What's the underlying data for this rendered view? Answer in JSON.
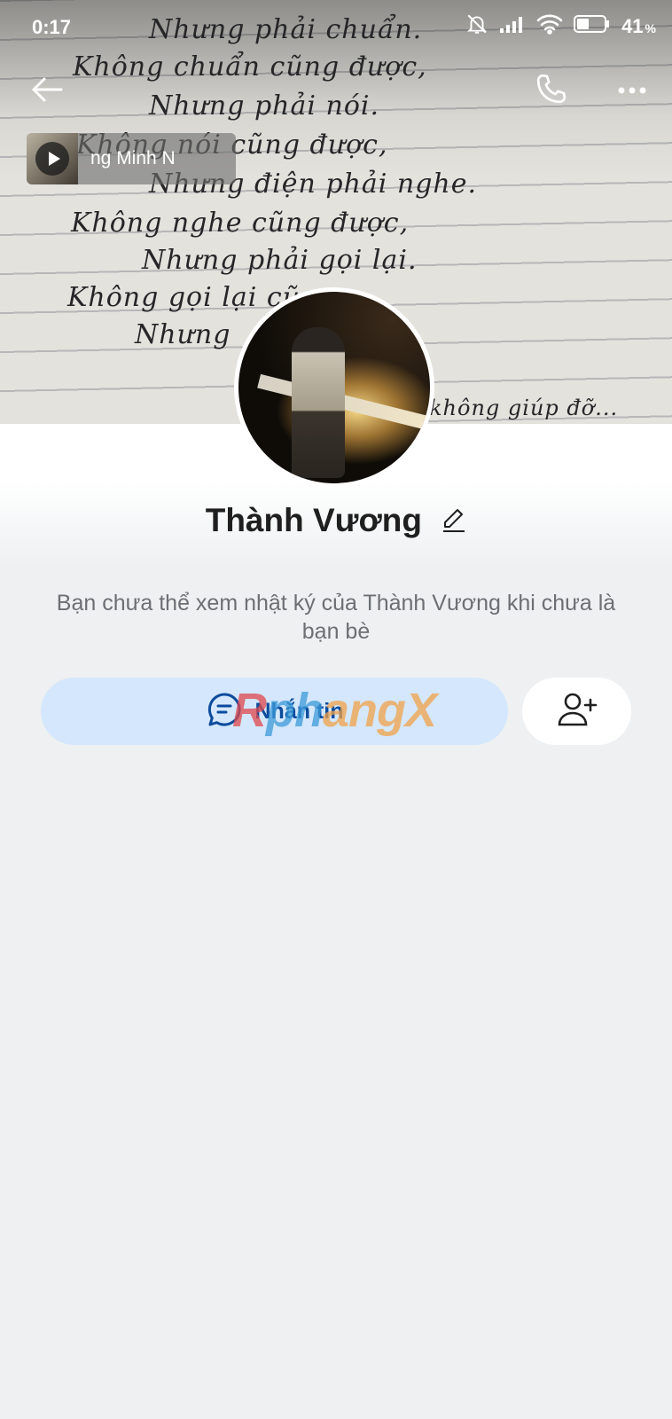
{
  "status_bar": {
    "time": "0:17",
    "battery": "41",
    "battery_unit": "%"
  },
  "cover": {
    "handwriting": [
      "Nhưng phải chuẩn.",
      "Không chuẩn cũng được,",
      "Nhưng phải nói.",
      "Không nói cũng được,",
      "Nhưng điện phải nghe.",
      "Không nghe cũng được,",
      "Nhưng phải gọi lại.",
      "Không gọi lại cũ",
      "Nhưng",
      "không giúp đỡ..."
    ]
  },
  "music": {
    "title": "ng Minh N"
  },
  "profile": {
    "name": "Thành Vương"
  },
  "notice": "Bạn chưa thể xem nhật ký của Thành Vương khi chưa là bạn bè",
  "actions": {
    "message_label": "Nhắn tin"
  },
  "watermark": {
    "part1": "R",
    "part2": "ph",
    "part3": "angX"
  },
  "icons": {
    "back": "arrow-left-icon",
    "call": "phone-icon",
    "more": "more-horizontal-icon",
    "edit": "pencil-icon",
    "message": "chat-icon",
    "add_friend": "add-user-icon"
  },
  "colors": {
    "accent": "#0b4b9c",
    "message_bg": "#d4e7fc",
    "page_bg": "#eef0f2"
  }
}
